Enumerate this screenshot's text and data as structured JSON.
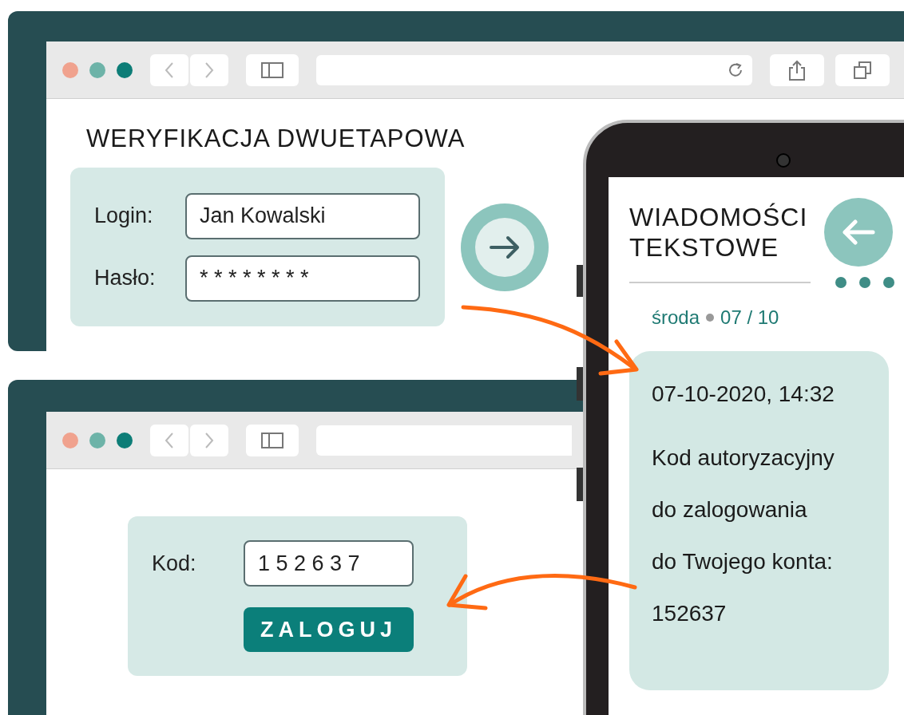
{
  "login_window": {
    "title": "WERYFIKACJA DWUETAPOWA",
    "fields": [
      {
        "label": "Login:",
        "value": "Jan Kowalski"
      },
      {
        "label": "Hasło:",
        "value": "* * * * * * * *"
      }
    ]
  },
  "code_window": {
    "fields": [
      {
        "label": "Kod:",
        "value": "1 5 2 6 3 7"
      }
    ],
    "button": "ZALOGUJ"
  },
  "phone": {
    "title_lines": [
      "WIADOMOŚCI",
      "TEKSTOWE"
    ],
    "day": "środa",
    "date": "07 / 10",
    "message": {
      "timestamp": "07-10-2020, 14:32",
      "lines": [
        "Kod autoryzacyjny",
        "do zalogowania",
        "do Twojego konta:",
        "152637"
      ]
    }
  }
}
